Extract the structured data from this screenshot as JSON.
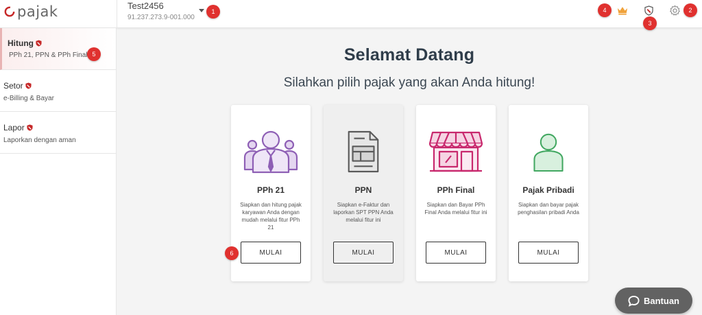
{
  "app": {
    "logo_text": "pajak",
    "accent": "#e0312f"
  },
  "header": {
    "company_name": "Test2456",
    "company_npwp": "91.237.273.9-001.000",
    "badges": [
      "1",
      "2",
      "3",
      "4"
    ]
  },
  "sidebar": {
    "items": [
      {
        "title": "Hitung",
        "subtitle": "PPh 21, PPN & PPh Final",
        "badge": "5",
        "active": true
      },
      {
        "title": "Setor",
        "subtitle": "e-Billing & Bayar"
      },
      {
        "title": "Lapor",
        "subtitle": "Laporkan dengan aman"
      }
    ]
  },
  "main": {
    "title": "Selamat Datang",
    "subtitle": "Silahkan pilih pajak yang akan Anda hitung!",
    "cards": [
      {
        "title": "PPh 21",
        "description": "Siapkan dan hitung pajak karyawan Anda dengan mudah melalui fitur PPh 21",
        "button": "MULAI",
        "icon": "employees-icon",
        "color": "#8e5fb5",
        "badge": "6"
      },
      {
        "title": "PPN",
        "description": "Siapkan e-Faktur dan laporkan SPT PPN Anda melalui fitur ini",
        "button": "MULAI",
        "icon": "document-icon",
        "color": "#5a5a5a"
      },
      {
        "title": "PPh Final",
        "description": "Siapkan dan Bayar PPh Final Anda melalui fitur ini",
        "button": "MULAI",
        "icon": "storefront-icon",
        "color": "#c8286d"
      },
      {
        "title": "Pajak Pribadi",
        "description": "Siapkan dan bayar pajak penghasilan pribadi Anda",
        "button": "MULAI",
        "icon": "person-icon",
        "color": "#43a862"
      }
    ]
  },
  "help": {
    "label": "Bantuan"
  }
}
